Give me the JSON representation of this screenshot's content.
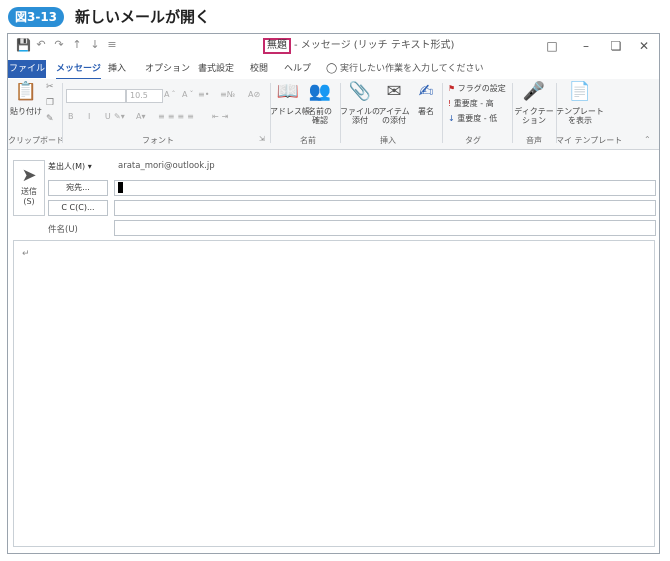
{
  "caption": {
    "figure_no": "図3-13",
    "title": "新しいメールが開く"
  },
  "titlebar": {
    "highlight": "無題",
    "rest": "- メッセージ (リッチ テキスト形式)",
    "qat": [
      "save-icon",
      "undo-icon",
      "redo-icon",
      "up-icon",
      "down-icon",
      "customize-icon"
    ]
  },
  "tabs": {
    "file": "ファイル",
    "message": "メッセージ",
    "insert": "挿入",
    "options": "オプション",
    "format": "書式設定",
    "review": "校閲",
    "help": "ヘルプ",
    "tellme": "実行したい作業を入力してください"
  },
  "ribbon": {
    "clipboard": {
      "paste": "貼り付け",
      "label": "クリップボード"
    },
    "font": {
      "size": "10.5",
      "label": "フォント"
    },
    "names": {
      "address_book": "アドレス帳",
      "check_names": "名前の確認",
      "label": "名前"
    },
    "insert": {
      "attach_file": "ファイルの添付",
      "attach_item": "アイテムの添付",
      "signature": "署名",
      "label": "挿入"
    },
    "tags": {
      "follow_up": "フラグの設定",
      "high": "重要度 - 高",
      "low": "重要度 - 低",
      "label": "タグ"
    },
    "voice": {
      "dictate": "ディクテーション",
      "label": "音声"
    },
    "templates": {
      "view": "テンプレートを表示",
      "label": "マイ テンプレート"
    }
  },
  "compose": {
    "send": "送信",
    "send_key": "(S)",
    "from_button": "差出人(M)",
    "from_address": "arata_mori@outlook.jp",
    "to_button": "宛先...",
    "cc_button": "C C(C)...",
    "subject_label": "件名(U)",
    "body_mark": "↵"
  },
  "colors": {
    "accent": "#2b5fb3",
    "highlight": "#c42a6a",
    "badge": "#2b8fd6"
  }
}
